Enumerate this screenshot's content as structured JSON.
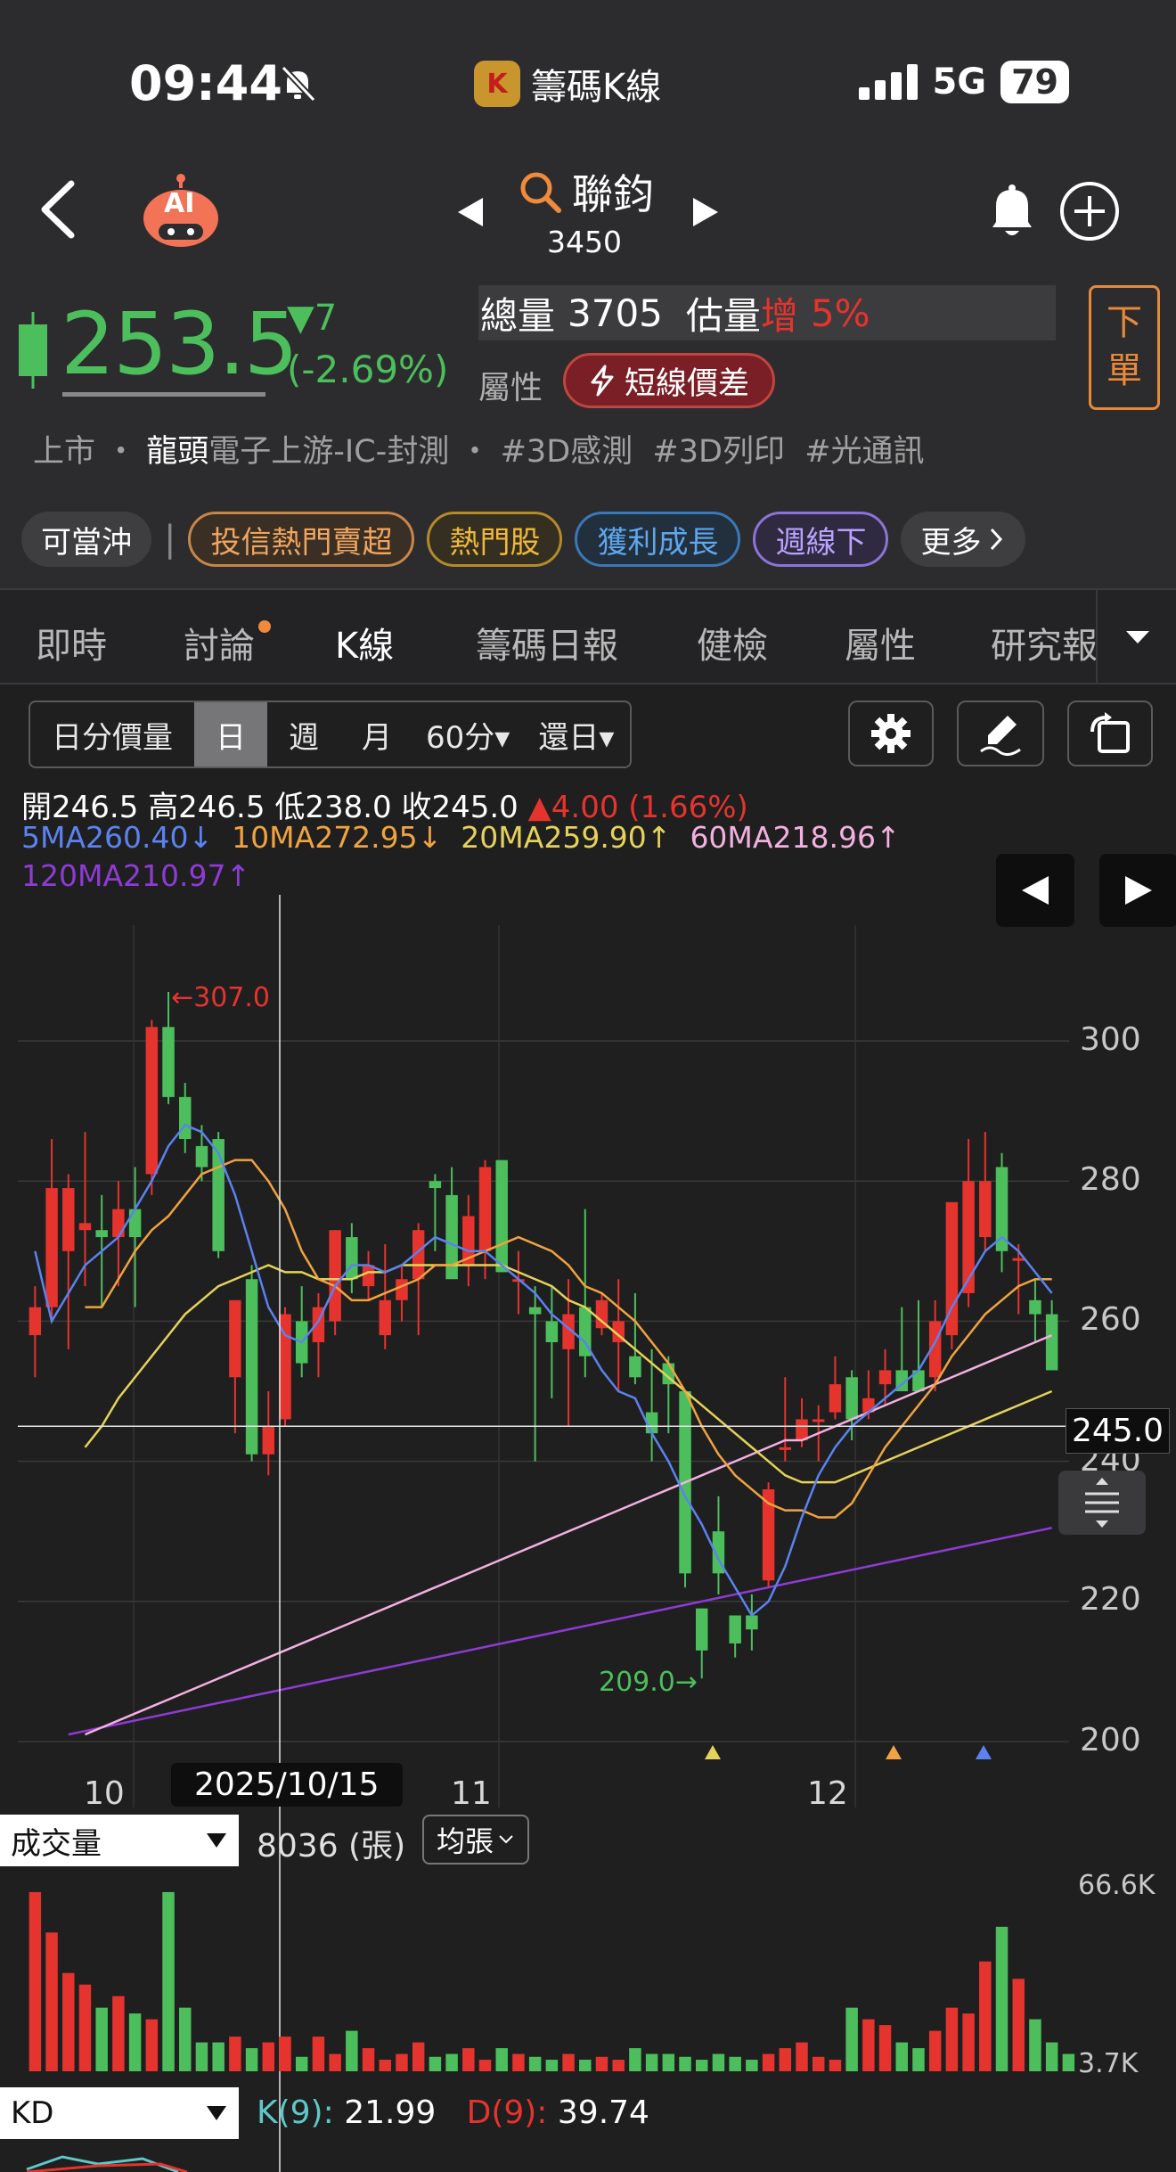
{
  "status_bar": {
    "time": "09:44",
    "app_logo_text": "K",
    "app_name": "籌碼K線",
    "network": "5G",
    "battery": "79"
  },
  "header": {
    "ai_label": "AI",
    "stock_name": "聯鈞",
    "stock_code": "3450"
  },
  "price": {
    "current": "253.5",
    "change": "▼7",
    "change_pct": "(-2.69%)",
    "volume_label": "總量",
    "volume_value": "3705",
    "est_label": "估量",
    "est_dir": "增",
    "est_pct": "5%",
    "attr_label": "屬性",
    "attr_badge": "短線價差",
    "order_button": "下單",
    "tags": {
      "market": "上市",
      "leader": "龍頭",
      "sector": "電子上游-IC-封測",
      "t1": "#3D感測",
      "t2": "#3D列印",
      "t3": "#光通訊"
    }
  },
  "chips": {
    "daytrade": "可當沖",
    "c1": "投信熱門賣超",
    "c2": "熱門股",
    "c3": "獲利成長",
    "c4": "週線下",
    "more": "更多"
  },
  "tabs": [
    "即時",
    "討論",
    "K線",
    "籌碼日報",
    "健檢",
    "屬性",
    "研究報"
  ],
  "chart_toolbar": {
    "periods": [
      "日分價量",
      "日",
      "週",
      "月",
      "60分▾",
      "還日▾"
    ]
  },
  "ohlc": {
    "open_label": "開",
    "open": "246.5",
    "high_label": "高",
    "high": "246.5",
    "low_label": "低",
    "low": "238.0",
    "close_label": "收",
    "close": "245.0",
    "chg": "▲4.00 (1.66%)"
  },
  "ma": {
    "ma5": "5MA260.40↓",
    "ma10": "10MA272.95↓",
    "ma20": "20MA259.90↑",
    "ma60": "60MA218.96↑",
    "ma120": "120MA210.97↑"
  },
  "colors": {
    "up": "#e5332e",
    "down": "#4cbf5c",
    "ma5": "#5b82f0",
    "ma10": "#f0a340",
    "ma20": "#e5d25a",
    "ma60": "#f3b0e0",
    "ma120": "#8e3bd6"
  },
  "chart_data": {
    "type": "candlestick",
    "y_ticks": [
      "300",
      "280",
      "260",
      "240",
      "220",
      "200"
    ],
    "ylim": [
      200,
      310
    ],
    "x_ticks": [
      "10",
      "11",
      "12"
    ],
    "crosshair_date": "2025/10/15",
    "crosshair_price": "245.0",
    "annotations": {
      "high": "←307.0",
      "low": "209.0→"
    },
    "candles": [
      {
        "o": 258,
        "h": 265,
        "l": 252,
        "c": 262
      },
      {
        "o": 262,
        "h": 286,
        "l": 260,
        "c": 279
      },
      {
        "o": 270,
        "h": 281,
        "l": 256,
        "c": 279
      },
      {
        "o": 273,
        "h": 287,
        "l": 265,
        "c": 274
      },
      {
        "o": 273,
        "h": 278,
        "l": 262,
        "c": 272
      },
      {
        "o": 272,
        "h": 280,
        "l": 265,
        "c": 276
      },
      {
        "o": 276,
        "h": 282,
        "l": 262,
        "c": 272
      },
      {
        "o": 281,
        "h": 303,
        "l": 278,
        "c": 302
      },
      {
        "o": 302,
        "h": 307,
        "l": 291,
        "c": 292
      },
      {
        "o": 292,
        "h": 294,
        "l": 284,
        "c": 286
      },
      {
        "o": 285,
        "h": 288,
        "l": 280,
        "c": 282
      },
      {
        "o": 286,
        "h": 287,
        "l": 269,
        "c": 270
      },
      {
        "o": 252,
        "h": 262,
        "l": 244,
        "c": 263
      },
      {
        "o": 266,
        "h": 268,
        "l": 240,
        "c": 241
      },
      {
        "o": 241,
        "h": 250,
        "l": 238,
        "c": 245
      },
      {
        "o": 246,
        "h": 262,
        "l": 245,
        "c": 261
      },
      {
        "o": 260,
        "h": 265,
        "l": 252,
        "c": 254
      },
      {
        "o": 257,
        "h": 264,
        "l": 252,
        "c": 262
      },
      {
        "o": 260,
        "h": 273,
        "l": 258,
        "c": 273
      },
      {
        "o": 272,
        "h": 274,
        "l": 264,
        "c": 266
      },
      {
        "o": 265,
        "h": 270,
        "l": 263,
        "c": 268
      },
      {
        "o": 258,
        "h": 271,
        "l": 256,
        "c": 263
      },
      {
        "o": 263,
        "h": 268,
        "l": 260,
        "c": 266
      },
      {
        "o": 266,
        "h": 274,
        "l": 258,
        "c": 273
      },
      {
        "o": 280,
        "h": 281,
        "l": 270,
        "c": 279
      },
      {
        "o": 278,
        "h": 282,
        "l": 268,
        "c": 266
      },
      {
        "o": 268,
        "h": 278,
        "l": 265,
        "c": 275
      },
      {
        "o": 270,
        "h": 283,
        "l": 266,
        "c": 282
      },
      {
        "o": 283,
        "h": 283,
        "l": 267,
        "c": 267
      },
      {
        "o": 266,
        "h": 270,
        "l": 261,
        "c": 266
      },
      {
        "o": 262,
        "h": 265,
        "l": 240,
        "c": 261
      },
      {
        "o": 260,
        "h": 265,
        "l": 249,
        "c": 257
      },
      {
        "o": 256,
        "h": 266,
        "l": 245,
        "c": 261
      },
      {
        "o": 262,
        "h": 276,
        "l": 252,
        "c": 255
      },
      {
        "o": 259,
        "h": 264,
        "l": 258,
        "c": 263
      },
      {
        "o": 257,
        "h": 266,
        "l": 250,
        "c": 260
      },
      {
        "o": 255,
        "h": 264,
        "l": 251,
        "c": 252
      },
      {
        "o": 247,
        "h": 256,
        "l": 240,
        "c": 244
      },
      {
        "o": 254,
        "h": 255,
        "l": 244,
        "c": 251
      },
      {
        "o": 250,
        "h": 250,
        "l": 222,
        "c": 224
      },
      {
        "o": 219,
        "h": 219,
        "l": 209,
        "c": 213
      },
      {
        "o": 230,
        "h": 235,
        "l": 221,
        "c": 224
      },
      {
        "o": 218,
        "h": 218,
        "l": 212,
        "c": 214
      },
      {
        "o": 218,
        "h": 221,
        "l": 213,
        "c": 216
      },
      {
        "o": 223,
        "h": 237,
        "l": 222,
        "c": 236
      },
      {
        "o": 242,
        "h": 252,
        "l": 240,
        "c": 242
      },
      {
        "o": 243,
        "h": 249,
        "l": 242,
        "c": 246
      },
      {
        "o": 246,
        "h": 248,
        "l": 240,
        "c": 246
      },
      {
        "o": 247,
        "h": 255,
        "l": 246,
        "c": 251
      },
      {
        "o": 252,
        "h": 253,
        "l": 243,
        "c": 246
      },
      {
        "o": 247,
        "h": 253,
        "l": 246,
        "c": 249
      },
      {
        "o": 251,
        "h": 256,
        "l": 248,
        "c": 253
      },
      {
        "o": 253,
        "h": 262,
        "l": 250,
        "c": 250
      },
      {
        "o": 253,
        "h": 263,
        "l": 251,
        "c": 250
      },
      {
        "o": 252,
        "h": 263,
        "l": 250,
        "c": 260
      },
      {
        "o": 258,
        "h": 275,
        "l": 256,
        "c": 277
      },
      {
        "o": 264,
        "h": 286,
        "l": 262,
        "c": 280
      },
      {
        "o": 272,
        "h": 287,
        "l": 270,
        "c": 280
      },
      {
        "o": 282,
        "h": 284,
        "l": 267,
        "c": 270
      },
      {
        "o": 269,
        "h": 271,
        "l": 261,
        "c": 269
      },
      {
        "o": 263,
        "h": 266,
        "l": 257,
        "c": 261
      },
      {
        "o": 261,
        "h": 263,
        "l": 253,
        "c": 253
      }
    ],
    "ma5": [
      270,
      260,
      264,
      268,
      270,
      272,
      276,
      280,
      285,
      288,
      287,
      284,
      278,
      270,
      262,
      258,
      257,
      260,
      265,
      268,
      268,
      267,
      268,
      270,
      272,
      271,
      270,
      270,
      268,
      266,
      264,
      261,
      259,
      257,
      253,
      250,
      249,
      244,
      240,
      235,
      231,
      226,
      222,
      218,
      220,
      225,
      232,
      238,
      242,
      245,
      247,
      249,
      251,
      253,
      257,
      262,
      266,
      270,
      272,
      270,
      267,
      264
    ],
    "ma10": [
      262,
      262,
      266,
      270,
      273,
      275,
      278,
      281,
      282,
      283,
      283,
      280,
      276,
      270,
      266,
      265,
      263,
      263,
      264,
      265,
      266,
      268,
      268,
      269,
      270,
      271,
      272,
      271,
      270,
      268,
      265,
      264,
      262,
      260,
      257,
      254,
      250,
      245,
      241,
      238,
      236,
      234,
      233,
      233,
      232,
      232,
      234,
      238,
      242,
      245,
      248,
      251,
      255,
      258,
      261,
      263,
      265,
      266,
      266
    ],
    "ma20": [
      242,
      245,
      249,
      252,
      255,
      258,
      261,
      263,
      265,
      266,
      267,
      268,
      267,
      267,
      266,
      266,
      266,
      267,
      267,
      268,
      268,
      268,
      268,
      268,
      268,
      268,
      267,
      266,
      265,
      263,
      262,
      260,
      258,
      256,
      254,
      252,
      250,
      248,
      246,
      244,
      242,
      240,
      238,
      237,
      237,
      237,
      238,
      239,
      240,
      241,
      242,
      243,
      244,
      245,
      246,
      247,
      248,
      249,
      250
    ],
    "ma60": [
      201,
      202,
      203,
      204,
      205,
      206,
      207,
      208,
      209,
      210,
      211,
      212,
      213,
      214,
      215,
      216,
      217,
      218,
      219,
      220,
      221,
      222,
      223,
      224,
      225,
      226,
      227,
      228,
      229,
      230,
      231,
      232,
      233,
      234,
      235,
      236,
      237,
      238,
      239,
      240,
      241,
      242,
      243,
      243,
      244,
      245,
      246,
      247,
      248,
      249,
      250,
      251,
      252,
      253,
      254,
      255,
      256,
      257,
      258
    ],
    "ma120": [
      201,
      201.5,
      202,
      202.5,
      203,
      203.5,
      204,
      204.5,
      205,
      205.5,
      206,
      206.5,
      207,
      207.5,
      208,
      208.5,
      209,
      209.5,
      210,
      210.5,
      211,
      211.5,
      212,
      212.5,
      213,
      213.5,
      214,
      214.5,
      215,
      215.5,
      216,
      216.5,
      217,
      217.5,
      218,
      218.5,
      219,
      219.5,
      220,
      220.5,
      221,
      221.5,
      222,
      222.5,
      223,
      223.5,
      224,
      224.5,
      225,
      225.5,
      226,
      226.5,
      227,
      227.5,
      228,
      228.5,
      229,
      229.5,
      230,
      230.5
    ],
    "volume": {
      "max_label": "66.6K",
      "min_label": "3.7K",
      "select": "成交量",
      "value": "8036 (張)",
      "unit_button": "均張",
      "bars": [
        62,
        48,
        34,
        30,
        22,
        26,
        20,
        18,
        62,
        22,
        10,
        10,
        12,
        8,
        10,
        12,
        5,
        12,
        6,
        14,
        8,
        4,
        6,
        10,
        5,
        6,
        8,
        4,
        8,
        6,
        5,
        4,
        6,
        4,
        5,
        4,
        8,
        6,
        6,
        5,
        4,
        6,
        5,
        4,
        6,
        8,
        10,
        5,
        4,
        22,
        18,
        16,
        10,
        8,
        14,
        22,
        20,
        38,
        50,
        32,
        18,
        10,
        6
      ]
    },
    "kd": {
      "select": "KD",
      "k_label": "K(9):",
      "k": "21.99",
      "d_label": "D(9):",
      "d": "39.74"
    }
  }
}
